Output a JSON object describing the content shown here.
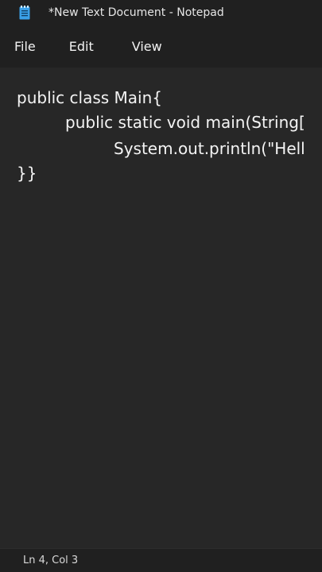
{
  "window": {
    "title": "*New Text Document - Notepad",
    "icon": "notepad-icon"
  },
  "menu": {
    "items": [
      {
        "label": "File"
      },
      {
        "label": "Edit"
      },
      {
        "label": "View"
      }
    ]
  },
  "editor": {
    "lines": [
      "public class Main{",
      "public static void main(String[",
      "System.out.println(\"Hell",
      "}}"
    ]
  },
  "status": {
    "position": "Ln 4, Col 3"
  },
  "colors": {
    "background": "#272727",
    "chrome": "#202020",
    "text": "#f4f4f4",
    "icon_accent": "#3aa0e8"
  }
}
